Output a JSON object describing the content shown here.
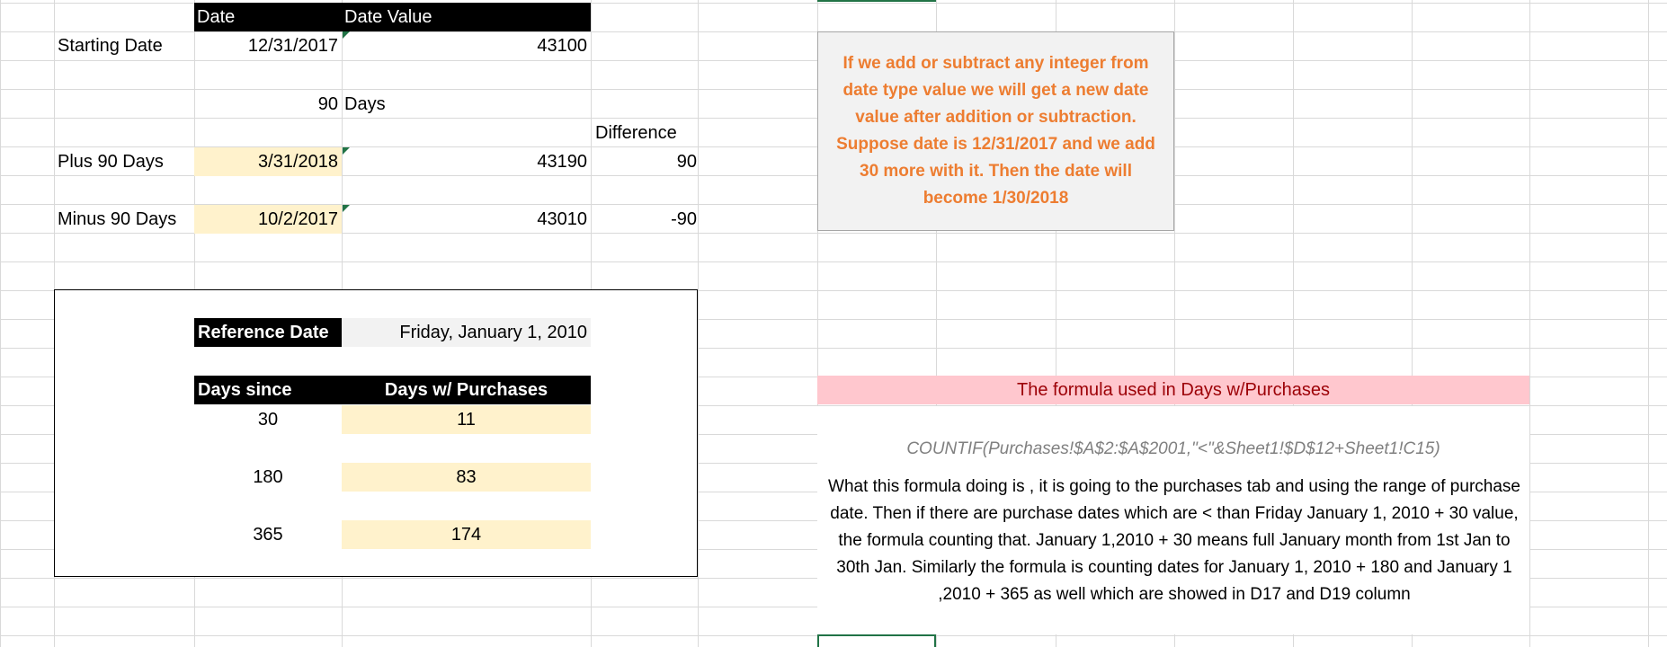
{
  "sheet": {
    "top_table": {
      "header": {
        "date": "Date",
        "date_value": "Date Value"
      },
      "rows": {
        "starting": {
          "label": "Starting Date",
          "date": "12/31/2017",
          "value": "43100"
        },
        "offset": {
          "number": "90",
          "unit": "Days"
        },
        "difference_label": "Difference",
        "plus": {
          "label": "Plus 90 Days",
          "date": "3/31/2018",
          "value": "43190",
          "difference": "90"
        },
        "minus": {
          "label": "Minus 90 Days",
          "date": "10/2/2017",
          "value": "43010",
          "difference": "-90"
        }
      }
    },
    "note": {
      "text": "If we add or subtract any integer from date type value we will get a new date value after addition or subtraction. Suppose date is  12/31/2017 and we add 30 more with it. Then the date will become 1/30/2018",
      "color": "#ed7d31"
    },
    "purchases_table": {
      "reference_label": "Reference Date",
      "reference_value": "Friday, January 1, 2010",
      "col_days_since": "Days since",
      "col_days_purchases": "Days w/ Purchases",
      "rows": [
        {
          "days": "30",
          "purchases": "11"
        },
        {
          "days": "180",
          "purchases": "83"
        },
        {
          "days": "365",
          "purchases": "174"
        }
      ]
    },
    "formula_panel": {
      "title": "The formula used in Days w/Purchases",
      "formula": "COUNTIF(Purchases!$A$2:$A$2001,\"<\"&Sheet1!$D$12+Sheet1!C15)",
      "explanation": "What this formula doing is , it is going to the purchases tab and using the range of purchase date. Then if there are purchase dates which are < than Friday January 1, 2010 + 30 value, the formula counting that. January 1,2010 + 30 means full January month from 1st Jan to 30th Jan. Similarly the formula is counting dates for January 1, 2010 + 180 and January 1 ,2010 + 365 as well which are showed in D17 and D19 column"
    },
    "colors": {
      "header_fill": "#000000",
      "input_fill": "#fff2cc",
      "pink_fill": "#ffc7ce",
      "pink_text": "#9c0006",
      "grid": "#d9d9d9",
      "selection": "#217346"
    }
  }
}
